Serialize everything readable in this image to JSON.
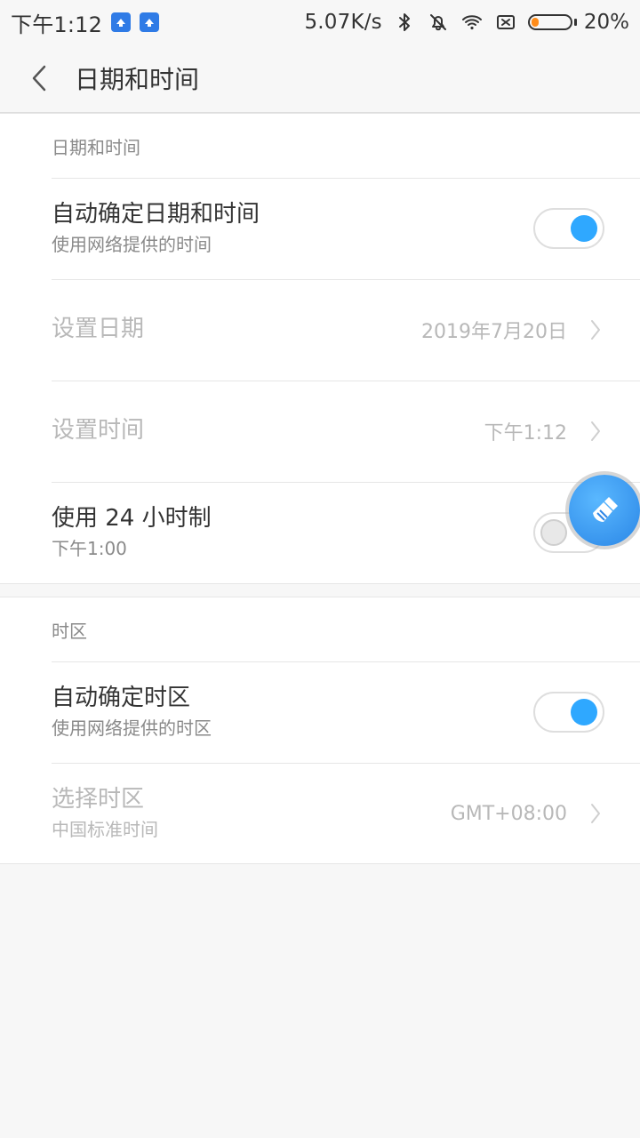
{
  "status_bar": {
    "time": "下午1:12",
    "speed": "5.07K/s",
    "battery": "20%",
    "battery_level": 0.2,
    "icons": [
      "app-icon",
      "app-icon",
      "bluetooth-icon",
      "mute-bell-icon",
      "wifi-icon",
      "sim-off-icon",
      "battery-icon"
    ]
  },
  "header": {
    "title": "日期和时间"
  },
  "sections": [
    {
      "header": "日期和时间",
      "items": [
        {
          "title": "自动确定日期和时间",
          "subtitle": "使用网络提供的时间",
          "toggle": true
        },
        {
          "title": "设置日期",
          "value": "2019年7月20日"
        },
        {
          "title": "设置时间",
          "value": "下午1:12"
        },
        {
          "title": "使用 24 小时制",
          "subtitle": "下午1:00",
          "toggle": false
        }
      ]
    },
    {
      "header": "时区",
      "items": [
        {
          "title": "自动确定时区",
          "subtitle": "使用网络提供的时区",
          "toggle": true
        },
        {
          "title": "选择时区",
          "subtitle": "中国标准时间",
          "value": "GMT+08:00"
        }
      ]
    }
  ],
  "colors": {
    "accent": "#2fa8ff",
    "background": "#f7f7f7",
    "card": "#ffffff",
    "text_primary": "#333333",
    "text_secondary": "#8a8a8a",
    "text_disabled": "#b8b8b8",
    "battery_fill": "#ff8c1a"
  }
}
